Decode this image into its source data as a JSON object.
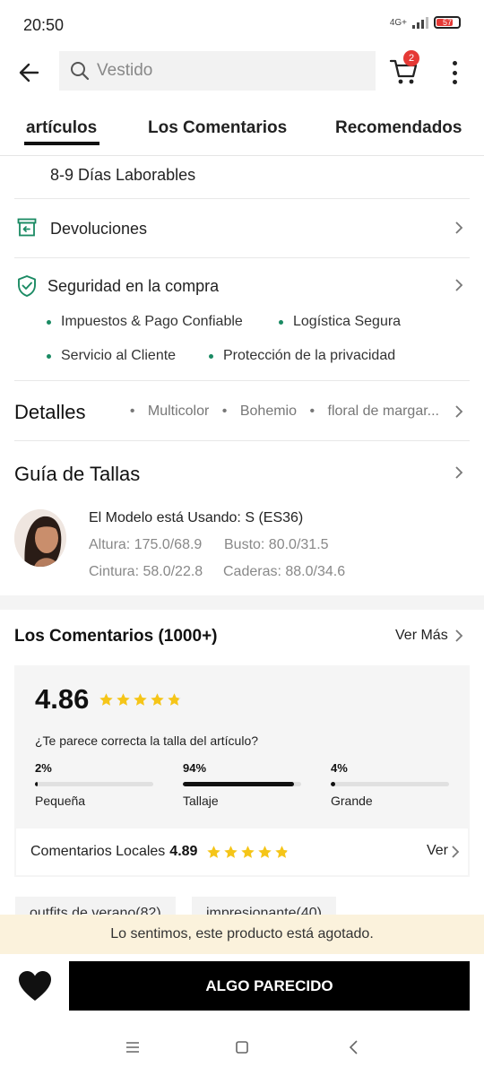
{
  "status": {
    "time": "20:50",
    "network": "4G+",
    "battery": "57"
  },
  "search": {
    "placeholder": "Vestido"
  },
  "cart": {
    "count": "2"
  },
  "tabs": [
    {
      "label": "artículos",
      "active": true
    },
    {
      "label": "Los Comentarios",
      "active": false
    },
    {
      "label": "Recomendados",
      "active": false
    }
  ],
  "shipping": {
    "delivery_text": "8-9 Días Laborables"
  },
  "returns": {
    "label": "Devoluciones"
  },
  "security": {
    "label": "Seguridad en la compra",
    "items": [
      "Impuestos & Pago Confiable",
      "Logística Segura",
      "Servicio al Cliente",
      "Protección de la privacidad"
    ]
  },
  "details": {
    "title": "Detalles",
    "tags": [
      "Multicolor",
      "Bohemio",
      "floral de margar..."
    ]
  },
  "size_guide": {
    "title": "Guía de Tallas",
    "model_using": "El Modelo está Usando: S (ES36)",
    "height": "Altura: 175.0/68.9",
    "bust": "Busto: 80.0/31.5",
    "waist": "Cintura: 58.0/22.8",
    "hips": "Caderas: 88.0/34.6"
  },
  "reviews": {
    "title": "Los Comentarios (1000+)",
    "see_more": "Ver Más",
    "rating": "4.86",
    "rating_stars": 4.86,
    "fit_question": "¿Te parece correcta la talla del artículo?",
    "fit": [
      {
        "percent": "2%",
        "label": "Pequeña",
        "value": 0.02
      },
      {
        "percent": "94%",
        "label": "Tallaje",
        "value": 0.94
      },
      {
        "percent": "4%",
        "label": "Grande",
        "value": 0.04
      }
    ],
    "local_label": "Comentarios Locales",
    "local_rating": "4.89",
    "local_rating_stars": 4.89,
    "local_view": "Ver",
    "tags": [
      "outfits de verano(82)",
      "impresionante(40)"
    ]
  },
  "sold_out_message": "Lo sentimos, este producto está agotado.",
  "similar_button": "ALGO PARECIDO",
  "colors": {
    "accent_green": "#1a8a63",
    "star_yellow": "#f5c518",
    "badge_red": "#e53935",
    "soldout_bg": "#fbf2dc"
  }
}
